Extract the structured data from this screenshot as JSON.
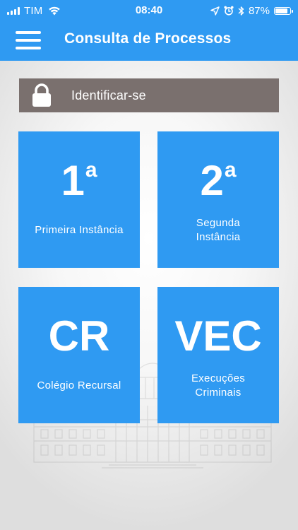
{
  "status_bar": {
    "carrier": "TIM",
    "time": "08:40",
    "battery_percent_text": "87%",
    "battery_level": 0.87,
    "icons": [
      "signal-bars-icon",
      "wifi-icon",
      "location-arrow-icon",
      "alarm-clock-icon",
      "bluetooth-icon",
      "battery-icon"
    ]
  },
  "header": {
    "title": "Consulta de Processos",
    "menu_icon": "hamburger-menu-icon"
  },
  "login": {
    "label": "Identificar-se",
    "icon": "lock-icon"
  },
  "tiles": [
    {
      "main": "1",
      "sup": "a",
      "label": "Primeira Instância"
    },
    {
      "main": "2",
      "sup": "a",
      "label_line1": "Segunda",
      "label_line2": "Instância"
    },
    {
      "main": "CR",
      "label": "Colégio Recursal"
    },
    {
      "main": "VEC",
      "label_line1": "Execuções",
      "label_line2": "Criminais"
    }
  ],
  "colors": {
    "primary": "#2f9af2",
    "login_bar": "#7a706e",
    "text_on_primary": "#ffffff"
  }
}
